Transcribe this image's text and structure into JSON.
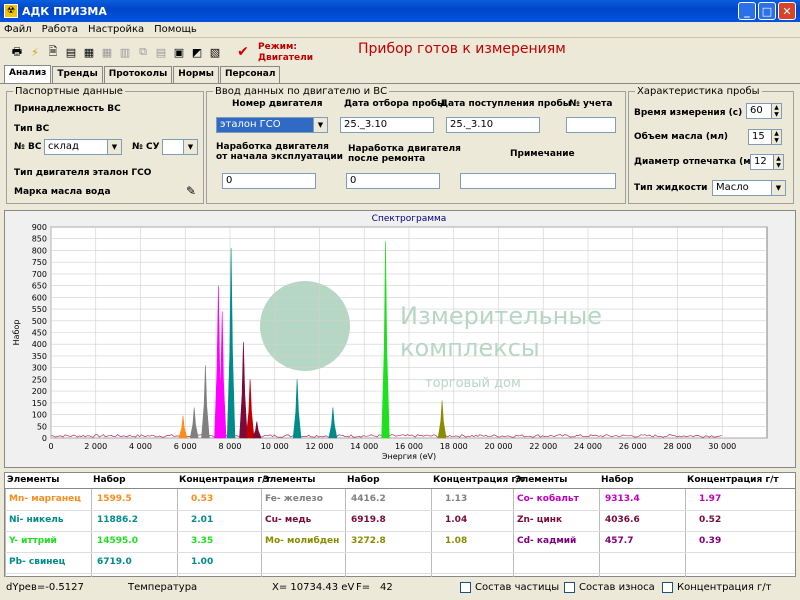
{
  "window": {
    "title": "АДК ПРИЗМА"
  },
  "menu": [
    "Файл",
    "Работа",
    "Настройка",
    "Помощь"
  ],
  "header": {
    "mode_label": "Режим:",
    "mode_value": "Двигатели",
    "status": "Прибор готов к измерениям"
  },
  "tabs": [
    "Анализ",
    "Тренды",
    "Протоколы",
    "Нормы",
    "Персонал"
  ],
  "passport": {
    "legend": "Паспортные данные",
    "affiliation_label": "Принадлежность ВС",
    "type_label": "Тип ВС",
    "vs_no_label": "№ ВС",
    "vs_no_value": "склад",
    "su_no_label": "№ СУ",
    "su_no_value": "",
    "engine_type_label": "Тип двигателя эталон ГСО",
    "oil_brand_label": "Марка масла вода"
  },
  "engine_input": {
    "legend": "Ввод данных по двигателю и ВС",
    "engine_no_label": "Номер двигателя",
    "engine_no_value": "эталон ГСО",
    "sample_date_label": "Дата отбора пробы",
    "sample_date_value": "25._3.10",
    "receipt_date_label": "Дата поступления пробы",
    "receipt_date_value": "25._3.10",
    "record_no_label": "№ учета",
    "record_no_value": "",
    "runtime_start_label_1": "Наработка двигателя",
    "runtime_start_label_2": "от начала эксплуатации",
    "runtime_start_value": "0",
    "runtime_repair_label_1": "Наработка двигателя",
    "runtime_repair_label_2": "после ремонта",
    "runtime_repair_value": "0",
    "note_label": "Примечание",
    "note_value": ""
  },
  "sample": {
    "legend": "Характеристика пробы",
    "time_label": "Время измерения (с)",
    "time_value": "60",
    "volume_label": "Объем масла (мл)",
    "volume_value": "15",
    "diameter_label": "Диаметр отпечатка (мм)",
    "diameter_value": "12",
    "liquid_label": "Тип жидкости",
    "liquid_value": "Масло"
  },
  "chart_data": {
    "type": "line",
    "title": "Спектрограмма",
    "xlabel": "Энергия (eV)",
    "ylabel": "Набор",
    "xlim": [
      0,
      32000
    ],
    "ylim": [
      0,
      900
    ],
    "x_ticks": [
      "0",
      "2 000",
      "4 000",
      "6 000",
      "8 000",
      "10 000",
      "12 000",
      "14 000",
      "16 000",
      "18 000",
      "20 000",
      "22 000",
      "24 000",
      "26 000",
      "28 000",
      "30 000"
    ],
    "y_ticks": [
      "0",
      "50",
      "100",
      "150",
      "200",
      "250",
      "300",
      "350",
      "400",
      "450",
      "500",
      "550",
      "600",
      "650",
      "700",
      "750",
      "800",
      "850",
      "900"
    ],
    "peaks": [
      {
        "x": 5900,
        "height": 95,
        "color": "#ff8c1a"
      },
      {
        "x": 6400,
        "height": 130,
        "color": "#808080"
      },
      {
        "x": 6900,
        "height": 310,
        "color": "#808080"
      },
      {
        "x": 7480,
        "height": 650,
        "color": "#ff00ff"
      },
      {
        "x": 7650,
        "height": 540,
        "color": "#ff00ff"
      },
      {
        "x": 8050,
        "height": 810,
        "color": "#008b8b"
      },
      {
        "x": 8600,
        "height": 410,
        "color": "#7a0a3a"
      },
      {
        "x": 8900,
        "height": 250,
        "color": "#c00000"
      },
      {
        "x": 9200,
        "height": 70,
        "color": "#7a0a3a"
      },
      {
        "x": 11000,
        "height": 250,
        "color": "#008b8b"
      },
      {
        "x": 12600,
        "height": 130,
        "color": "#008b8b"
      },
      {
        "x": 14950,
        "height": 840,
        "color": "#1ee01e"
      },
      {
        "x": 17480,
        "height": 160,
        "color": "#8b8b00"
      }
    ]
  },
  "watermark": {
    "line1": "Измерительные",
    "line2": "комплексы",
    "line3": "торговый дом"
  },
  "table": {
    "headers": [
      "Элементы",
      "Набор",
      "Концентрация г/т"
    ],
    "rows": [
      [
        {
          "name": "Mn- марганец",
          "count": "1599.5",
          "conc": "0.53",
          "color": "#ff8c1a"
        },
        {
          "name": "Fe- железо",
          "count": "4416.2",
          "conc": "1.13",
          "color": "#808080"
        },
        {
          "name": "Co- кобальт",
          "count": "9313.4",
          "conc": "1.97",
          "color": "#c000c0"
        }
      ],
      [
        {
          "name": "Ni- никель",
          "count": "11886.2",
          "conc": "2.01",
          "color": "#008b8b"
        },
        {
          "name": "Cu- медь",
          "count": "6919.8",
          "conc": "1.04",
          "color": "#7a0a3a"
        },
        {
          "name": "Zn- цинк",
          "count": "4036.6",
          "conc": "0.52",
          "color": "#7a0a3a"
        }
      ],
      [
        {
          "name": "Y- иттрий",
          "count": "14595.0",
          "conc": "3.35",
          "color": "#1ee01e"
        },
        {
          "name": "Mo- молибден",
          "count": "3272.8",
          "conc": "1.08",
          "color": "#8b8b00"
        },
        {
          "name": "Cd- кадмий",
          "count": "457.7",
          "conc": "0.39",
          "color": "#800080"
        }
      ],
      [
        {
          "name": "Pb- свинец",
          "count": "6719.0",
          "conc": "1.00",
          "color": "#008b8b"
        },
        {
          "name": "",
          "count": "",
          "conc": "",
          "color": "#000"
        },
        {
          "name": "",
          "count": "",
          "conc": "",
          "color": "#000"
        }
      ]
    ]
  },
  "statusbar": {
    "dyrev": "dYрев=-0.5127",
    "temperature": "Температура",
    "x_readout": "X= 10734.43 eV",
    "f_label": "F=",
    "f_value": "42",
    "chk1": "Состав частицы",
    "chk2": "Состав износа",
    "chk3": "Концентрация г/т"
  }
}
